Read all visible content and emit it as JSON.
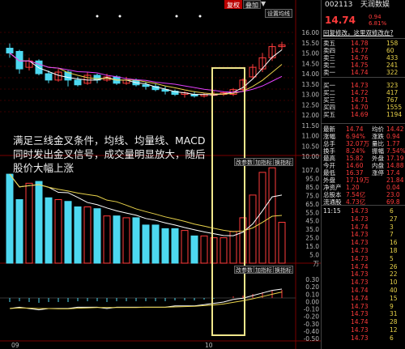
{
  "toolbar": {
    "fuquan": "复权",
    "diejia": "叠加",
    "marker_glyph": "▼",
    "settings": "设置均线"
  },
  "indicator_buttons": {
    "mod_param": "改参数",
    "add_ind": "加指标",
    "switch_ind": "换指标"
  },
  "price_axis": [
    "16.00",
    "15.50",
    "15.00",
    "14.50",
    "14.00",
    "13.50",
    "13.00",
    "12.50",
    "12.00",
    "11.50",
    "11.00",
    "10.50",
    "10.00"
  ],
  "vol_axis": [
    "107.0",
    "95.0",
    "85.0",
    "75.0",
    "65.0",
    "55.0",
    "45.0",
    "35.0",
    "25.0",
    "15.0",
    "5.0",
    "万"
  ],
  "macd_axis": [
    "0.30",
    "0.20",
    "0.10",
    "0.00",
    "-0.10",
    "-0.20",
    "-0.30",
    "-0.40",
    "-0.50"
  ],
  "date_labels": [
    "09",
    "10"
  ],
  "annotation": {
    "line1": "满足三线金叉条件，均线、均量线、MACD",
    "line2": "同时发出金叉信号，成交量明显放大，随后",
    "line3": "股价大幅上涨"
  },
  "stock": {
    "code": "002113",
    "name": "天润数娱",
    "price": "14.74",
    "change": "0.94",
    "pct": "6.81%",
    "notice": "回复修改，这里双修改在?"
  },
  "asks": [
    {
      "label": "卖五",
      "price": "14.78",
      "vol": "158"
    },
    {
      "label": "卖四",
      "price": "14.77",
      "vol": "60"
    },
    {
      "label": "卖三",
      "price": "14.76",
      "vol": "433"
    },
    {
      "label": "卖二",
      "price": "14.75",
      "vol": "241"
    },
    {
      "label": "卖一",
      "price": "14.74",
      "vol": "322"
    }
  ],
  "bids": [
    {
      "label": "买一",
      "price": "14.73",
      "vol": "323"
    },
    {
      "label": "买二",
      "price": "14.72",
      "vol": "417"
    },
    {
      "label": "买三",
      "price": "14.71",
      "vol": "767"
    },
    {
      "label": "买四",
      "price": "14.70",
      "vol": "1555"
    },
    {
      "label": "买五",
      "price": "14.69",
      "vol": "1194"
    }
  ],
  "quote": [
    {
      "k": "最新",
      "v": "14.74",
      "k2": "均价",
      "v2": "14.42"
    },
    {
      "k": "涨幅",
      "v": "6.94%",
      "k2": "涨跌",
      "v2": "0.94"
    },
    {
      "k": "总手",
      "v": "32.07万",
      "k2": "量比",
      "v2": "1.77"
    },
    {
      "k": "换手",
      "v": "8.24%",
      "k2": "振幅",
      "v2": "7.54%"
    },
    {
      "k": "最高",
      "v": "15.82",
      "k2": "外盘",
      "v2": "17.19"
    },
    {
      "k": "今开",
      "v": "14.60",
      "k2": "内盘",
      "v2": "14.88"
    },
    {
      "k": "最低",
      "v": "16.37",
      "k2": "涨停",
      "v2": "17.4"
    },
    {
      "k": "外盘",
      "v": "17.19万",
      "k2": "",
      "v2": "21.84"
    },
    {
      "k": "净资产",
      "v": "1.20",
      "k2": "",
      "v2": "0.04"
    },
    {
      "k": "总股本",
      "v": "7.54亿",
      "k2": "",
      "v2": "23.0"
    },
    {
      "k": "流通股",
      "v": "4.73亿",
      "k2": "",
      "v2": "69.8"
    }
  ],
  "ticks": [
    {
      "t": "11:15",
      "p": "14.73",
      "v": "6"
    },
    {
      "t": "",
      "p": "14.73",
      "v": "27"
    },
    {
      "t": "",
      "p": "14.74",
      "v": "3"
    },
    {
      "t": "",
      "p": "14.73",
      "v": "7"
    },
    {
      "t": "",
      "p": "14.73",
      "v": "16"
    },
    {
      "t": "",
      "p": "14.73",
      "v": "18"
    },
    {
      "t": "",
      "p": "14.73",
      "v": "5"
    },
    {
      "t": "",
      "p": "14.74",
      "v": "26"
    },
    {
      "t": "",
      "p": "14.73",
      "v": "22"
    },
    {
      "t": "",
      "p": "14.73",
      "v": "10"
    },
    {
      "t": "",
      "p": "14.74",
      "v": "40"
    },
    {
      "t": "",
      "p": "14.74",
      "v": "15"
    },
    {
      "t": "",
      "p": "14.73",
      "v": "9"
    },
    {
      "t": "",
      "p": "14.73",
      "v": "31"
    },
    {
      "t": "",
      "p": "14.74",
      "v": "28"
    },
    {
      "t": "",
      "p": "14.73",
      "v": "12"
    },
    {
      "t": "",
      "p": "14.73",
      "v": "6"
    }
  ],
  "chart_data": {
    "type": "bar",
    "candles": [
      {
        "o": 14.6,
        "c": 14.3,
        "h": 14.9,
        "l": 14.0
      },
      {
        "o": 14.4,
        "c": 13.3,
        "h": 14.5,
        "l": 13.0
      },
      {
        "o": 13.4,
        "c": 13.8,
        "h": 14.0,
        "l": 13.2
      },
      {
        "o": 13.8,
        "c": 13.0,
        "h": 13.9,
        "l": 12.9
      },
      {
        "o": 13.0,
        "c": 12.6,
        "h": 13.2,
        "l": 12.4
      },
      {
        "o": 12.6,
        "c": 13.1,
        "h": 13.3,
        "l": 12.5
      },
      {
        "o": 13.1,
        "c": 12.6,
        "h": 13.2,
        "l": 12.2
      },
      {
        "o": 12.6,
        "c": 12.3,
        "h": 12.8,
        "l": 12.2
      },
      {
        "o": 12.4,
        "c": 12.9,
        "h": 13.1,
        "l": 12.3
      },
      {
        "o": 12.9,
        "c": 12.6,
        "h": 13.0,
        "l": 12.4
      },
      {
        "o": 12.6,
        "c": 12.8,
        "h": 13.0,
        "l": 12.5
      },
      {
        "o": 12.8,
        "c": 12.4,
        "h": 12.9,
        "l": 12.3
      },
      {
        "o": 12.4,
        "c": 12.6,
        "h": 12.8,
        "l": 12.3
      },
      {
        "o": 12.6,
        "c": 12.3,
        "h": 12.7,
        "l": 12.2
      },
      {
        "o": 12.3,
        "c": 12.2,
        "h": 12.5,
        "l": 12.0
      },
      {
        "o": 12.2,
        "c": 12.0,
        "h": 12.4,
        "l": 11.9
      },
      {
        "o": 12.0,
        "c": 11.9,
        "h": 12.2,
        "l": 11.7
      },
      {
        "o": 11.9,
        "c": 11.7,
        "h": 12.0,
        "l": 11.6
      },
      {
        "o": 11.7,
        "c": 11.8,
        "h": 11.9,
        "l": 11.5
      },
      {
        "o": 11.7,
        "c": 11.6,
        "h": 11.9,
        "l": 11.5
      },
      {
        "o": 11.6,
        "c": 11.7,
        "h": 11.8,
        "l": 11.5
      },
      {
        "o": 11.7,
        "c": 11.7,
        "h": 11.9,
        "l": 11.6
      },
      {
        "o": 11.7,
        "c": 11.8,
        "h": 11.9,
        "l": 11.6
      },
      {
        "o": 11.7,
        "c": 12.0,
        "h": 12.1,
        "l": 11.6
      },
      {
        "o": 12.0,
        "c": 12.6,
        "h": 12.7,
        "l": 11.9
      },
      {
        "o": 12.8,
        "c": 13.4,
        "h": 13.6,
        "l": 12.7
      },
      {
        "o": 13.3,
        "c": 14.0,
        "h": 14.3,
        "l": 13.1
      },
      {
        "o": 14.0,
        "c": 14.7,
        "h": 14.9,
        "l": 13.8
      },
      {
        "o": 14.7,
        "c": 14.8,
        "h": 15.0,
        "l": 14.5
      }
    ],
    "volumes": [
      98,
      70,
      88,
      90,
      72,
      70,
      68,
      62,
      62,
      60,
      52,
      52,
      50,
      50,
      42,
      42,
      38,
      38,
      36,
      30,
      30,
      28,
      28,
      35,
      50,
      75,
      100,
      105,
      45
    ],
    "macd": [
      -0.05,
      -0.04,
      -0.05,
      -0.06,
      -0.05,
      -0.05,
      -0.05,
      -0.04,
      -0.04,
      -0.04,
      -0.05,
      -0.04,
      -0.04,
      -0.04,
      -0.04,
      -0.04,
      -0.04,
      -0.03,
      -0.03,
      -0.03,
      -0.02,
      -0.01,
      0.0,
      0.02,
      0.03,
      0.05,
      0.07,
      0.09,
      0.1
    ],
    "price_range": [
      10.0,
      16.0
    ],
    "vol_range": [
      0,
      107
    ],
    "macd_range": [
      -0.5,
      0.3
    ],
    "colors": {
      "up": "#ff3b3b",
      "down": "#4dd8f0",
      "ma1": "#ffffff",
      "ma2": "#e8d24a",
      "ma3": "#e040fb",
      "highlight": "#f0e68c"
    }
  }
}
